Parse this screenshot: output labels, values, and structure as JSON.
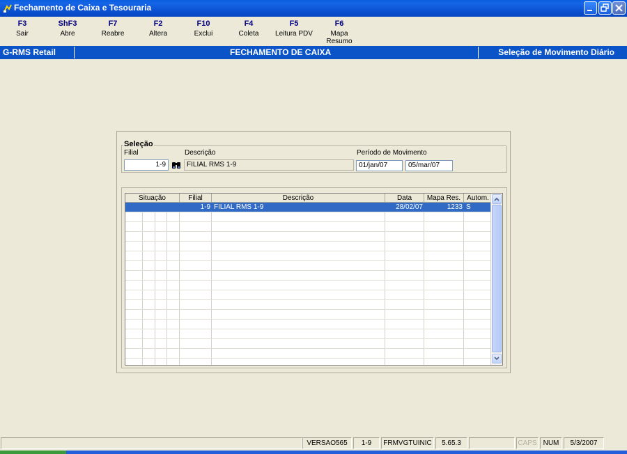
{
  "window": {
    "title": "Fechamento de Caixa e Tesouraria",
    "icon": "app-icon",
    "controls": [
      "minimize-icon",
      "restore-icon",
      "close-icon"
    ]
  },
  "toolbar": [
    {
      "key": "F3",
      "label": "Sair"
    },
    {
      "key": "ShF3",
      "label": "Abre"
    },
    {
      "key": "F7",
      "label": "Reabre"
    },
    {
      "key": "F2",
      "label": "Altera"
    },
    {
      "key": "F10",
      "label": "Exclui"
    },
    {
      "key": "F4",
      "label": "Coleta"
    },
    {
      "key": "F5",
      "label": "Leitura PDV"
    },
    {
      "key": "F6",
      "label": "Mapa Resumo"
    }
  ],
  "header": {
    "left": "G-RMS Retail",
    "center": "FECHAMENTO DE CAIXA",
    "right": "Seleção de Movimento Diário"
  },
  "selecao": {
    "title": "Seleção",
    "filial_label": "Filial",
    "filial_value": "1-9",
    "descricao_label": "Descrição",
    "descricao_value": "FILIAL RMS 1-9",
    "periodo_label": "Período de Movimento",
    "periodo_inicio": "01/jan/07",
    "periodo_fim": "05/mar/07",
    "search_icon": "binoculars-icon"
  },
  "grid": {
    "columns": [
      "Situação",
      "Filial",
      "Descrição",
      "Data",
      "Mapa Res.",
      "Autom."
    ],
    "rows": [
      {
        "filial": "1-9",
        "descricao": "FILIAL RMS 1-9",
        "data": "28/02/07",
        "mapa": "1233",
        "autom": "S"
      }
    ]
  },
  "statusbar": {
    "versao": "VERSAO565",
    "filial": "1-9",
    "form": "FRMVGTUINIC",
    "release": "5.65.3",
    "caps": "CAPS",
    "num": "NUM",
    "date": "5/3/2007"
  },
  "colors": {
    "titlebar": "#0a5fe0",
    "header_bar": "#0a54c8",
    "selection": "#316ac5",
    "background": "#ece9d8"
  }
}
